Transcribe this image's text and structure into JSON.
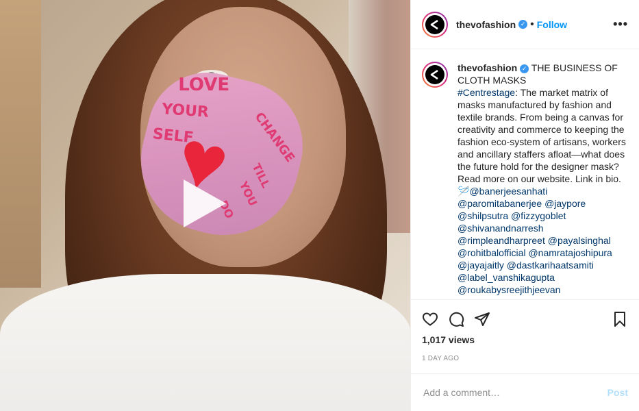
{
  "header": {
    "username": "thevofashion",
    "dot": "•",
    "follow_label": "Follow",
    "more_label": "•••"
  },
  "caption": {
    "username": "thevofashion",
    "title": "THE BUSINESS OF CLOTH MASKS",
    "hashtag": "#Centrestage",
    "body": ": The market matrix of masks manufactured by fashion and textile brands. From being a canvas for creativity and commerce to keeping the fashion eco-system of artisans, workers and ancillary staffers afloat—what does the future hold for the designer mask? Read more on our website. Link in bio.",
    "emoji": "🪡",
    "mentions": [
      "@banerjeesanhati",
      "@paromitabanerjee",
      "@jaypore",
      "@shilpsutra",
      "@fizzygoblet",
      "@shivanandnarresh",
      "@rimpleandharpreet",
      "@payalsinghal",
      "@rohitbalofficial",
      "@namratajoshipura",
      "@jayajaitly",
      "@dastkarihaatsamiti",
      "@label_vanshikagupta",
      "@roukabysreejithjeevan"
    ]
  },
  "media": {
    "mask_words": [
      "LOVE",
      "YOUR",
      "SELF",
      "CHANGE",
      "TILL",
      "YOU",
      "DO"
    ]
  },
  "actions": {
    "views": "1,017 views",
    "date": "1 DAY AGO"
  },
  "comment": {
    "placeholder": "Add a comment…",
    "post_label": "Post"
  },
  "colors": {
    "accent": "#0095f6",
    "post_disabled": "#b2dffc",
    "link": "#00376b",
    "verified": "#3897f0"
  }
}
